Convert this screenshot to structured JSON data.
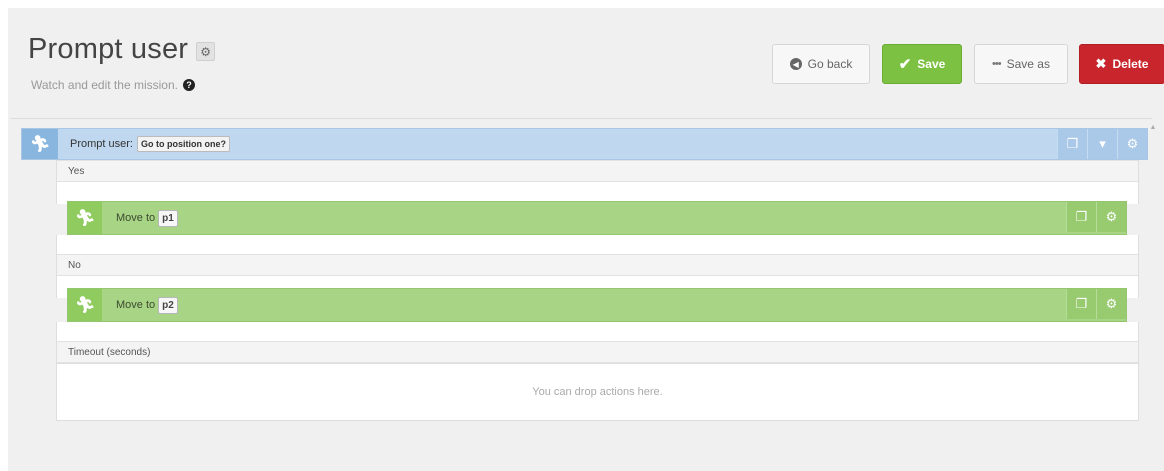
{
  "header": {
    "title": "Prompt user",
    "subtitle": "Watch and edit the mission.",
    "title_icon": "gear-icon",
    "help_icon": "question-circle-icon"
  },
  "toolbar": {
    "go_back": "Go back",
    "save": "Save",
    "save_as": "Save as",
    "delete": "Delete"
  },
  "mission": {
    "prompt": {
      "label": "Prompt user:",
      "value": "Go to position one?",
      "icon": "runner-icon"
    },
    "sections": [
      {
        "label": "Yes",
        "actions": [
          {
            "label": "Move to",
            "value": "p1",
            "icon": "runner-icon"
          }
        ]
      },
      {
        "label": "No",
        "actions": [
          {
            "label": "Move to",
            "value": "p2",
            "icon": "runner-icon"
          }
        ]
      },
      {
        "label": "Timeout (seconds)",
        "drop_hint": "You can drop actions here."
      }
    ]
  },
  "colors": {
    "prompt_bar": "#bfd8ef",
    "move_bar": "#a8d585",
    "save_button": "#7dc142",
    "delete_button": "#c9252c"
  }
}
